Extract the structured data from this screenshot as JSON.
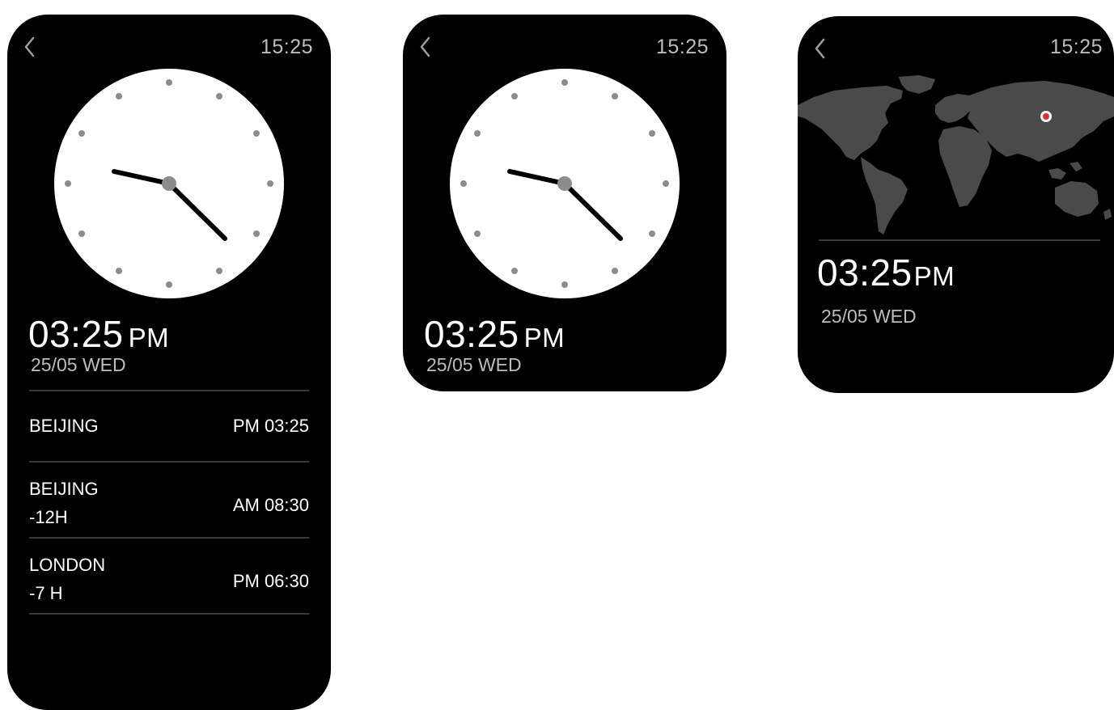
{
  "status_time": "15:25",
  "watch1": {
    "time": "03:25",
    "ampm": "PM",
    "date": "25/05 WED",
    "cities": [
      {
        "name": "BEIJING",
        "offset": "",
        "time": "PM 03:25"
      },
      {
        "name": "BEIJING",
        "offset": "-12H",
        "time": "AM 08:30"
      },
      {
        "name": "LONDON",
        "offset": "-7 H",
        "time": "PM 06:30"
      }
    ]
  },
  "watch2": {
    "time": "03:25",
    "ampm": "PM",
    "date": "25/05 WED"
  },
  "watch3": {
    "time": "03:25",
    "ampm": "PM",
    "date": "25/05 WED"
  },
  "colors": {
    "background": "#000000",
    "clock_face": "#ffffff",
    "tick": "#8c8c8c",
    "map_land": "#4a4a4a",
    "marker": "#e8283a",
    "secondary_text": "#bdbdbd"
  },
  "icons": {
    "back": "chevron-left-icon",
    "marker": "location-marker-icon"
  }
}
